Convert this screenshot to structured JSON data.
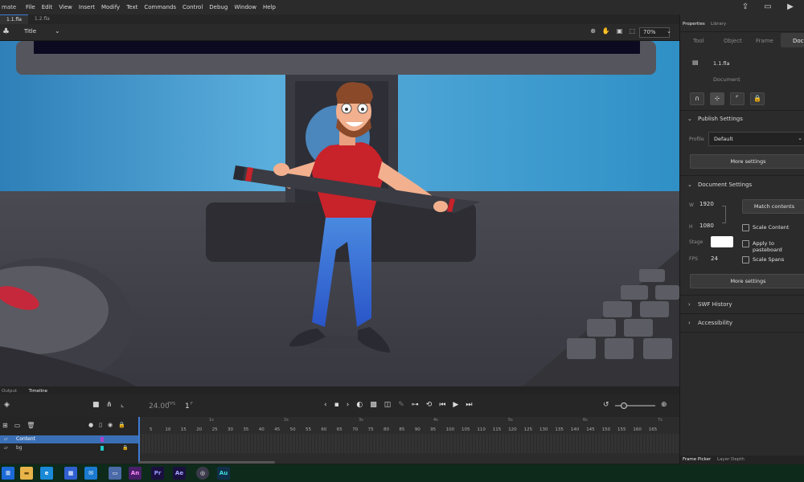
{
  "app": {
    "name": "mate",
    "menu": [
      "File",
      "Edit",
      "View",
      "Insert",
      "Modify",
      "Text",
      "Commands",
      "Control",
      "Debug",
      "Window",
      "Help"
    ]
  },
  "doc_tabs": [
    "1.1.fla",
    "1.2.fla"
  ],
  "editbar": {
    "scene_label": "Title",
    "zoom": "70%"
  },
  "timeline": {
    "tabs": [
      "Output",
      "Timeline"
    ],
    "fps": "24.00",
    "fps_unit": "FPS",
    "frame": "1",
    "frame_unit": "F",
    "layers": [
      {
        "name": "Content",
        "color": "#b040c8",
        "selected": true
      },
      {
        "name": "bg",
        "color": "#20c8c8",
        "selected": false
      }
    ],
    "second_markers": [
      "1s",
      "2s",
      "3s",
      "4s",
      "5s",
      "6s",
      "7s"
    ],
    "frame_numbers": [
      "5",
      "10",
      "15",
      "20",
      "25",
      "30",
      "35",
      "40",
      "45",
      "50",
      "55",
      "60",
      "65",
      "70",
      "75",
      "80",
      "85",
      "90",
      "95",
      "100",
      "105",
      "110",
      "115",
      "120",
      "125",
      "130",
      "135",
      "140",
      "145",
      "150",
      "155",
      "160",
      "165"
    ]
  },
  "panel": {
    "top_tabs": [
      "Properties",
      "Library"
    ],
    "prop_tabs": [
      "Tool",
      "Object",
      "Frame",
      "Doc"
    ],
    "doc_name": "1.1.fla",
    "doc_type": "Document",
    "publish": {
      "title": "Publish Settings",
      "profile_label": "Profile",
      "profile_value": "Default",
      "more": "More settings"
    },
    "document": {
      "title": "Document Settings",
      "w_label": "W",
      "w_value": "1920",
      "h_label": "H",
      "h_value": "1080",
      "match_btn": "Match contents",
      "scale_content": "Scale Content",
      "stage_label": "Stage",
      "stage_color": "#ffffff",
      "apply_pasteboard": "Apply to pasteboard",
      "fps_label": "FPS",
      "fps_value": "24",
      "scale_spans": "Scale Spans",
      "more": "More settings"
    },
    "swf_history": "SWF History",
    "accessibility": "Accessibility",
    "bottom_tabs": [
      "Frame Picker",
      "Layer Depth"
    ]
  },
  "taskbar": {
    "apps": [
      {
        "label": "An",
        "color": "#4a1e6a",
        "fg": "#ff8cf8"
      },
      {
        "label": "Pr",
        "color": "#1a1040",
        "fg": "#9b9bff"
      },
      {
        "label": "Ae",
        "color": "#1a1040",
        "fg": "#a8a8ff"
      },
      {
        "label": "Au",
        "color": "#10304a",
        "fg": "#40e0d8"
      }
    ]
  }
}
